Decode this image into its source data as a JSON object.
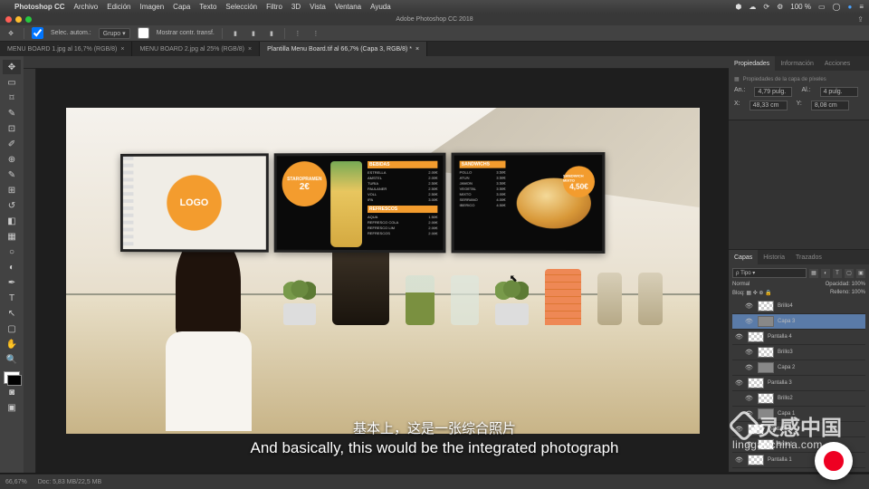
{
  "mac_menu": {
    "app": "Photoshop CC",
    "items": [
      "Archivo",
      "Edición",
      "Imagen",
      "Capa",
      "Texto",
      "Selección",
      "Filtro",
      "3D",
      "Vista",
      "Ventana",
      "Ayuda"
    ],
    "zoom": "100 %"
  },
  "window_title": "Adobe Photoshop CC 2018",
  "options": {
    "tool": "Selec. autom.:",
    "group": "Grupo",
    "transform": "Mostrar contr. transf."
  },
  "tabs": [
    {
      "label": "MENU BOARD 1.jpg al 16,7% (RGB/8)",
      "active": false
    },
    {
      "label": "MENU BOARD 2.jpg al 25% (RGB/8)",
      "active": false
    },
    {
      "label": "Plantilla Menu Board.tif al 66,7% (Capa 3, RGB/8) *",
      "active": true
    }
  ],
  "canvas": {
    "logo": "LOGO",
    "promo_top": "STAROPRAMEN",
    "promo_price": "2€",
    "col_bebidas": "BEBIDAS",
    "col_refrescos": "REFRESCOS",
    "col_sandwich": "SANDWICHS",
    "items_bebidas": [
      [
        "ESTRELLA",
        "2.00€"
      ],
      [
        "AMSTEL",
        "2.00€"
      ],
      [
        "TURIA",
        "2.50€"
      ],
      [
        "PAULANER",
        "2.50€"
      ],
      [
        "VOLL",
        "2.50€"
      ],
      [
        "IPA",
        "3.00€"
      ]
    ],
    "items_refrescos": [
      [
        "AQUA",
        "1.50€"
      ],
      [
        "REFRESCO COLA",
        "2.00€"
      ],
      [
        "REFRESCO LIM",
        "2.00€"
      ],
      [
        "REFRESCOS",
        "2.00€"
      ]
    ],
    "items_sandwich": [
      [
        "POLLO",
        "3.50€"
      ],
      [
        "ATUN",
        "3.50€"
      ],
      [
        "JAMON",
        "3.50€"
      ],
      [
        "VEGETAL",
        "3.50€"
      ],
      [
        "MIXTO",
        "3.00€"
      ],
      [
        "SERRANO",
        "4.00€"
      ],
      [
        "IBERICO",
        "4.50€"
      ]
    ],
    "tag_top": "SANDWICH MIXTO",
    "tag_price": "4,50€"
  },
  "properties": {
    "title": "Propiedades",
    "tab2": "Información",
    "tab3": "Acciones",
    "subtitle": "Propiedades de la capa de píxeles",
    "w_lbl": "An.:",
    "w": "4,79 pulg.",
    "h_lbl": "Al.:",
    "h": "4 pulg.",
    "x_lbl": "X:",
    "x": "48,33 cm",
    "y_lbl": "Y:",
    "y": "8,08 cm"
  },
  "layers_panel": {
    "tab1": "Capas",
    "tab2": "Historia",
    "tab3": "Trazados",
    "kind": "Tipo",
    "blend": "Normal",
    "opacity_lbl": "Opacidad:",
    "opacity": "100%",
    "lock_lbl": "Bloq:",
    "fill_lbl": "Relleno:",
    "fill": "100%",
    "layers": [
      {
        "name": "Brillo4",
        "indent": true,
        "sel": false,
        "checker": true
      },
      {
        "name": "Capa 3",
        "indent": true,
        "sel": true,
        "checker": false
      },
      {
        "name": "Pantalla  4",
        "indent": false,
        "sel": false,
        "checker": true
      },
      {
        "name": "Brillo3",
        "indent": true,
        "sel": false,
        "checker": true
      },
      {
        "name": "Capa 2",
        "indent": true,
        "sel": false,
        "checker": false
      },
      {
        "name": "Pantalla  3",
        "indent": false,
        "sel": false,
        "checker": true
      },
      {
        "name": "Brillo2",
        "indent": true,
        "sel": false,
        "checker": true
      },
      {
        "name": "Capa 1",
        "indent": true,
        "sel": false,
        "checker": false
      },
      {
        "name": "Pantalla  2",
        "indent": false,
        "sel": false,
        "checker": true
      },
      {
        "name": "Brillo1",
        "indent": true,
        "sel": false,
        "checker": true
      },
      {
        "name": "Pantalla  1",
        "indent": false,
        "sel": false,
        "checker": true
      }
    ]
  },
  "status": {
    "zoom": "66,67%",
    "doc": "Doc: 5,83 MB/22,5 MB"
  },
  "subtitles": {
    "cn": "基本上，这是一张综合照片",
    "en": "And basically, this would be the integrated photograph"
  },
  "watermark": {
    "brand": "灵感中国",
    "url": "lingganchina.com"
  }
}
